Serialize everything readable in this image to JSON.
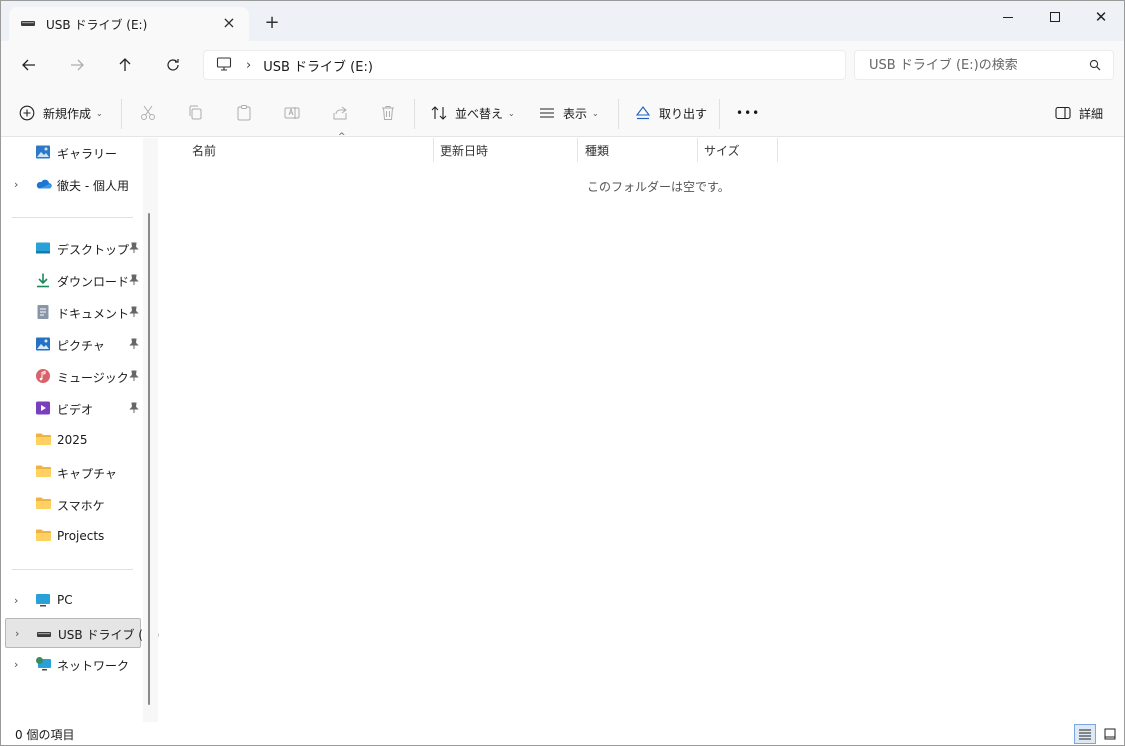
{
  "tab": {
    "title": "USB ドライブ (E:)"
  },
  "address": {
    "path": "USB ドライブ (E:)"
  },
  "search": {
    "placeholder": "USB ドライブ (E:)の検索"
  },
  "toolbar": {
    "new_label": "新規作成",
    "sort_label": "並べ替え",
    "view_label": "表示",
    "eject_label": "取り出す",
    "more_label": "•••",
    "details_label": "詳細"
  },
  "sidebar": {
    "top": [
      {
        "label": "ギャラリー",
        "icon": "gallery-icon"
      },
      {
        "label": "徹夫 - 個人用",
        "icon": "onedrive-icon"
      }
    ],
    "quick": [
      {
        "label": "デスクトップ",
        "icon": "desktop-icon"
      },
      {
        "label": "ダウンロード",
        "icon": "download-icon"
      },
      {
        "label": "ドキュメント",
        "icon": "document-icon"
      },
      {
        "label": "ピクチャ",
        "icon": "pictures-icon"
      },
      {
        "label": "ミュージック",
        "icon": "music-icon"
      },
      {
        "label": "ビデオ",
        "icon": "video-icon"
      },
      {
        "label": "2025",
        "icon": "folder-icon"
      },
      {
        "label": "キャプチャ",
        "icon": "folder-icon"
      },
      {
        "label": "スマホケ",
        "icon": "folder-icon"
      },
      {
        "label": "Projects",
        "icon": "folder-icon"
      }
    ],
    "bottom": [
      {
        "label": "PC",
        "icon": "pc-icon"
      },
      {
        "label": "USB ドライブ (E:)",
        "icon": "usb-drive-icon"
      },
      {
        "label": "ネットワーク",
        "icon": "network-icon"
      }
    ]
  },
  "columns": {
    "name": "名前",
    "date": "更新日時",
    "type": "種類",
    "size": "サイズ"
  },
  "content": {
    "empty_message": "このフォルダーは空です。"
  },
  "status": {
    "item_count": "0 個の項目"
  }
}
